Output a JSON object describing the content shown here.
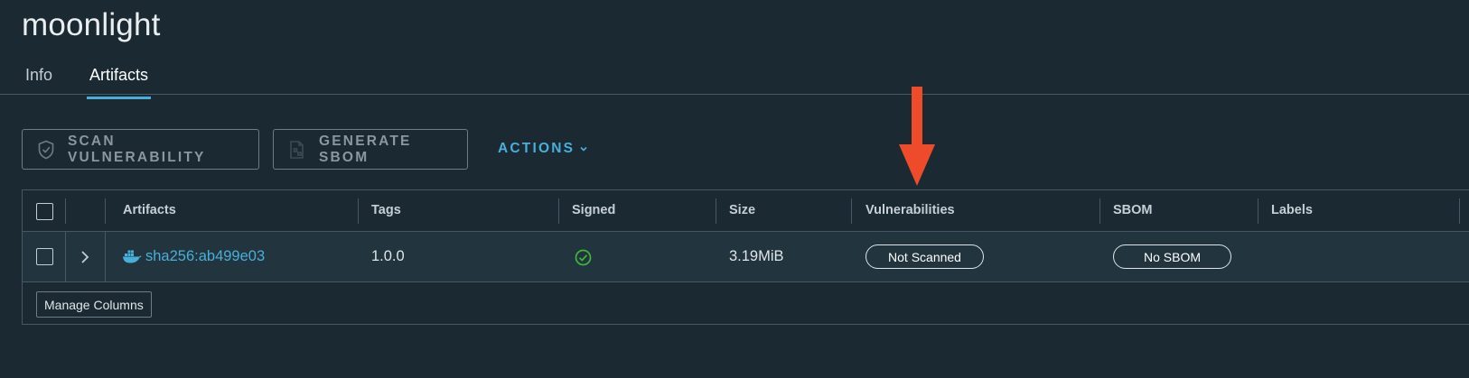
{
  "repo": {
    "title": "moonlight"
  },
  "tabs": [
    {
      "label": "Info"
    },
    {
      "label": "Artifacts"
    }
  ],
  "toolbar": {
    "scan_label": "SCAN VULNERABILITY",
    "sbom_label": "GENERATE SBOM",
    "actions_label": "ACTIONS",
    "scan_icon": "shield-check-icon",
    "sbom_icon": "sbom-document-icon",
    "actions_icon": "chevron-down-icon"
  },
  "table": {
    "columns": [
      "Artifacts",
      "Tags",
      "Signed",
      "Size",
      "Vulnerabilities",
      "SBOM",
      "Labels"
    ],
    "rows": [
      {
        "artifact": "sha256:ab499e03",
        "artifact_icon": "docker-icon",
        "tags": "1.0.0",
        "signed_icon": "check-circle-icon",
        "size": "3.19MiB",
        "vulnerabilities": "Not Scanned",
        "sbom": "No SBOM",
        "labels": ""
      }
    ],
    "manage_columns": "Manage Columns"
  },
  "annotation": {
    "icon": "red-arrow-down-icon",
    "color": "#ee4b2b"
  },
  "colors": {
    "background": "#1b2a32",
    "accent": "#49afd9",
    "success": "#3fb73f",
    "annotation": "#ee4b2b"
  }
}
